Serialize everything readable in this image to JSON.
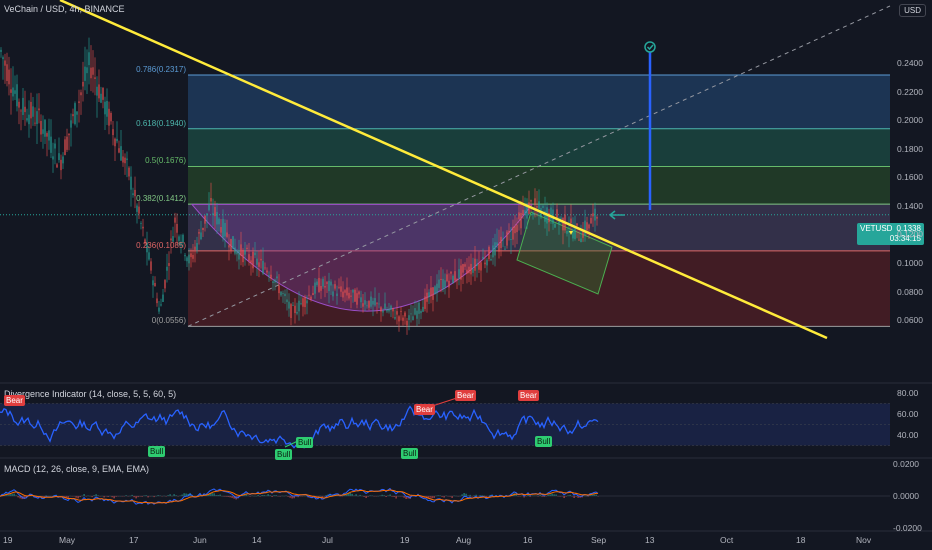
{
  "header": {
    "title": "VeChain / USD, 4h, BINANCE",
    "currency_button": "USD"
  },
  "price_axis": {
    "labels": [
      "0.2400",
      "0.2200",
      "0.2000",
      "0.1800",
      "0.1600",
      "0.1400",
      "0.1200",
      "0.1000",
      "0.0800",
      "0.0600"
    ],
    "values": [
      0.24,
      0.22,
      0.2,
      0.18,
      0.16,
      0.14,
      0.12,
      0.1,
      0.08,
      0.06
    ]
  },
  "price_tag": {
    "symbol": "VETUSD",
    "price": "0.1338",
    "countdown": "03:34:15"
  },
  "fib_levels": [
    {
      "label": "0.786(0.2317)",
      "value": 0.2317,
      "color": "#5b9bd5"
    },
    {
      "label": "0.618(0.1940)",
      "value": 0.194,
      "color": "#4db6ac"
    },
    {
      "label": "0.5(0.1676)",
      "value": 0.1676,
      "color": "#66bb6a"
    },
    {
      "label": "0.382(0.1412)",
      "value": 0.1412,
      "color": "#81c784"
    },
    {
      "label": "0.236(0.1085)",
      "value": 0.1085,
      "color": "#e06666"
    },
    {
      "label": "0(0.0556)",
      "value": 0.0556,
      "color": "#9e9e9e"
    }
  ],
  "time_axis": {
    "labels": [
      "19",
      "May",
      "17",
      "Jun",
      "14",
      "Jul",
      "19",
      "Aug",
      "16",
      "Sep",
      "13",
      "Oct",
      "18",
      "Nov"
    ]
  },
  "divergence": {
    "title": "Divergence Indicator (14, close, 5, 5, 60, 5)",
    "axis_labels": [
      "80.00",
      "60.00",
      "40.00"
    ],
    "axis_values": [
      80,
      60,
      40
    ],
    "bear_label": "Bear",
    "bull_label": "Bull"
  },
  "macd": {
    "title": "MACD (12, 26, close, 9, EMA, EMA)",
    "axis_labels": [
      "0.0200",
      "0.0000",
      "-0.0200"
    ],
    "axis_values": [
      0.02,
      0,
      -0.02
    ]
  },
  "colors": {
    "background": "#131722",
    "trendline": "#ffeb3b",
    "rsi_line": "#2962ff",
    "measure_arrow": "#2962ff",
    "macd_line": "#2962ff",
    "signal_line": "#ff6d00",
    "up": "#26a69a",
    "down": "#ef5350"
  },
  "icons": {
    "target": "check-circle-icon",
    "arrow": "arrow-left-icon"
  }
}
